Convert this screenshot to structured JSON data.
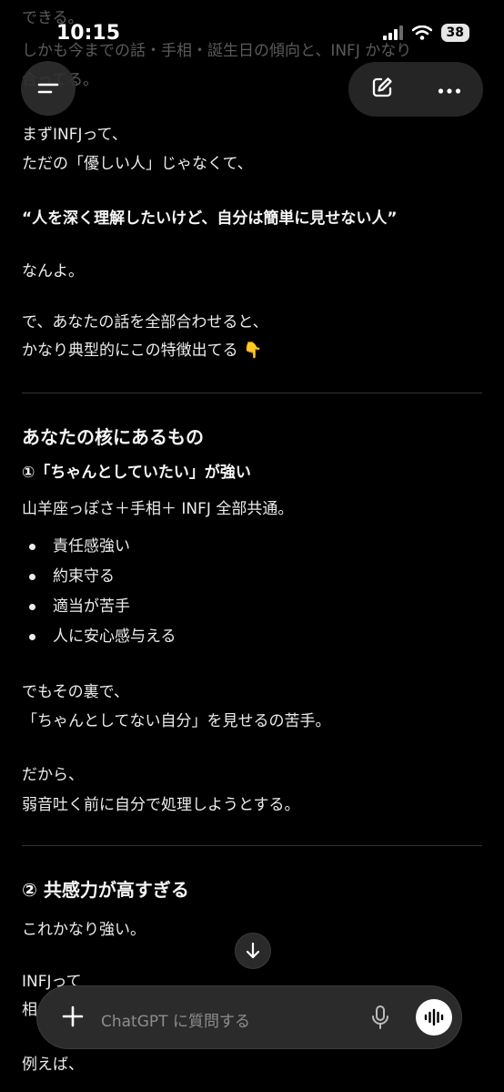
{
  "status_bar": {
    "time": "10:15",
    "battery": "38"
  },
  "chat": {
    "faded_lines": [
      "できる。",
      "しかも今までの話・手相・誕生日の傾向と、INFJ かなり",
      "合ってる。"
    ],
    "p1": [
      "まずINFJって、",
      "ただの「優しい人」じゃなくて、"
    ],
    "quote": "“人を深く理解したいけど、自分は簡単に見せない人”",
    "p2": "なんよ。",
    "p3": [
      "で、あなたの話を全部合わせると、",
      "かなり典型的にこの特徴出てる 👇"
    ],
    "section_heading": "あなたの核にあるもの",
    "sub1_heading": "①「ちゃんとしていたい」が強い",
    "sub1_intro": "山羊座っぽさ＋手相＋ INFJ 全部共通。",
    "bullets": [
      "責任感強い",
      "約束守る",
      "適当が苦手",
      "人に安心感与える"
    ],
    "p4": [
      "でもその裏で、",
      "「ちゃんとしてない自分」を見せるの苦手。"
    ],
    "p5": [
      "だから、",
      "弱音吐く前に自分で処理しようとする。"
    ],
    "sub2_heading": "② 共感力が高すぎる",
    "sub2_intro": "これかなり強い。",
    "bottom_lines": [
      "INFJって",
      "相",
      "例えば、"
    ]
  },
  "composer": {
    "placeholder": "ChatGPT に質問する"
  },
  "icons": {
    "menu": "menu-icon",
    "compose": "compose-icon",
    "more": "more-icon",
    "scroll_down": "arrow-down-icon",
    "plus": "plus-icon",
    "mic": "mic-icon",
    "voice": "voice-wave-icon"
  }
}
